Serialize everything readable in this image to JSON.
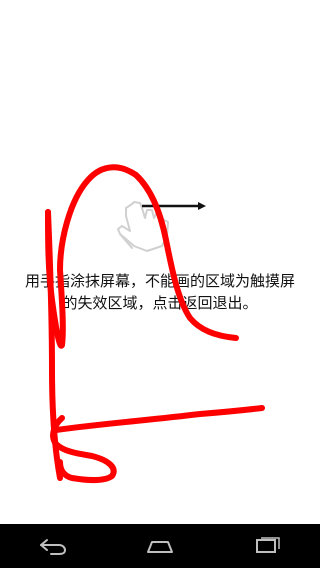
{
  "screen": {
    "instruction_line1": "用手指涂抹屏幕，不能画的区域为触摸屏",
    "instruction_line2": "的失效区域，点击返回退出。"
  },
  "gesture_hint": {
    "icon": "swipe-right-hand-icon",
    "color": "#d9d9d9",
    "arrow_color": "#111111"
  },
  "drawing": {
    "stroke_color": "#ff0000"
  },
  "navbar": {
    "background": "#000000",
    "icon_color": "#bfbfbf",
    "buttons": [
      {
        "name": "back",
        "icon": "back-arrow-icon"
      },
      {
        "name": "home",
        "icon": "home-icon"
      },
      {
        "name": "recent-apps",
        "icon": "recent-apps-icon"
      }
    ]
  }
}
